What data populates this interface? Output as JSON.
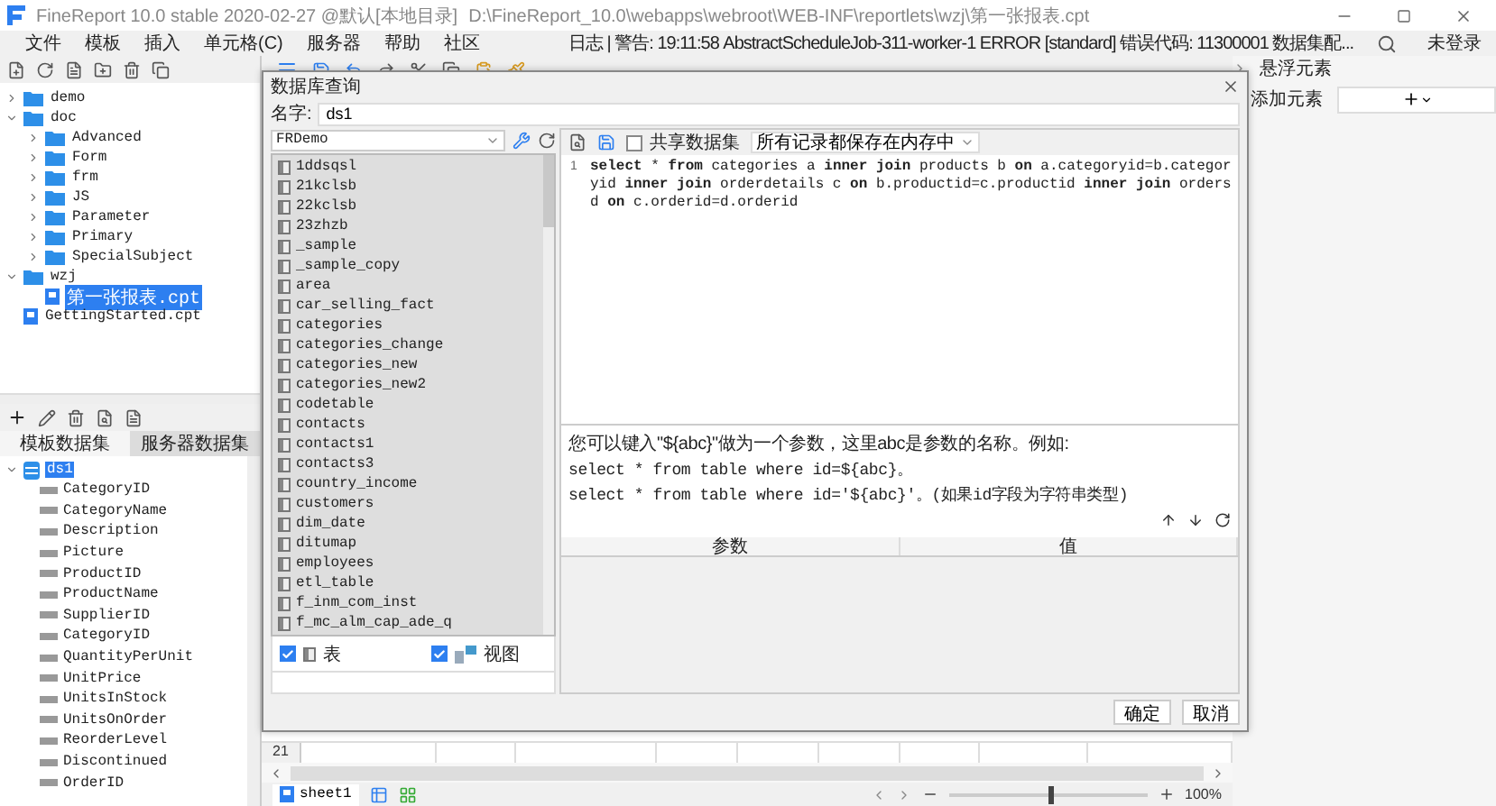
{
  "window": {
    "title": "FineReport 10.0 stable 2020-02-27 @默认[本地目录]",
    "path": "D:\\FineReport_10.0\\webapps\\webroot\\WEB-INF\\reportlets\\wzj\\第一张报表.cpt"
  },
  "menu": [
    "文件",
    "模板",
    "插入",
    "单元格(C)",
    "服务器",
    "帮助",
    "社区"
  ],
  "log_message": "日志 | 警告: 19:11:58 AbstractScheduleJob-311-worker-1 ERROR [standard] 错误代码: 11300001 数据集配...",
  "user": "未登录",
  "file_tree": [
    {
      "label": "demo",
      "kind": "folder",
      "expanded": false,
      "selected": false
    },
    {
      "label": "doc",
      "kind": "folder",
      "expanded": true,
      "selected": false,
      "children": [
        {
          "label": "Advanced",
          "kind": "folder",
          "expanded": false,
          "selected": false
        },
        {
          "label": "Form",
          "kind": "folder",
          "expanded": false,
          "selected": false
        },
        {
          "label": "frm",
          "kind": "folder",
          "expanded": false,
          "selected": false
        },
        {
          "label": "JS",
          "kind": "folder",
          "expanded": false,
          "selected": false
        },
        {
          "label": "Parameter",
          "kind": "folder",
          "expanded": false,
          "selected": false
        },
        {
          "label": "Primary",
          "kind": "folder",
          "expanded": false,
          "selected": false
        },
        {
          "label": "SpecialSubject",
          "kind": "folder",
          "expanded": false,
          "selected": false
        }
      ]
    },
    {
      "label": "wzj",
      "kind": "folder",
      "expanded": true,
      "selected": false,
      "children": [
        {
          "label": "第一张报表.cpt",
          "kind": "file",
          "selected": true
        }
      ]
    },
    {
      "label": "GettingStarted.cpt",
      "kind": "file",
      "selected": false
    }
  ],
  "dataset_tabs": [
    {
      "label": "模板数据集",
      "selected": true
    },
    {
      "label": "服务器数据集",
      "selected": false
    }
  ],
  "datasets": [
    {
      "name": "ds1",
      "expanded": true,
      "selected": true,
      "fields": [
        "CategoryID",
        "CategoryName",
        "Description",
        "Picture",
        "ProductID",
        "ProductName",
        "SupplierID",
        "CategoryID",
        "QuantityPerUnit",
        "UnitPrice",
        "UnitsInStock",
        "UnitsOnOrder",
        "ReorderLevel",
        "Discontinued",
        "OrderID"
      ]
    }
  ],
  "dialog": {
    "title": "数据库查询",
    "name_label": "名字:",
    "name_value": "ds1",
    "connection": "FRDemo",
    "tables": [
      "1ddsqsl",
      "21kclsb",
      "22kclsb",
      "23zhzb",
      "_sample",
      "_sample_copy",
      "area",
      "car_selling_fact",
      "categories",
      "categories_change",
      "categories_new",
      "categories_new2",
      "codetable",
      "contacts",
      "contacts1",
      "contacts3",
      "country_income",
      "customers",
      "dim_date",
      "ditumap",
      "employees",
      "etl_table",
      "f_inm_com_inst",
      "f_mc_alm_cap_ade_q"
    ],
    "filters": [
      {
        "label": "表",
        "kind": "table",
        "checked": true
      },
      {
        "label": "视图",
        "kind": "view",
        "checked": true
      }
    ],
    "share_dataset": {
      "label": "共享数据集",
      "checked": false
    },
    "storage_mode": "所有记录都保存在内存中",
    "sql_lines": [
      {
        "number": "1",
        "code": "**select**  *  **from** categories a  **inner join**  products  b **on** a.categoryid=b.categoryid **inner join**  orderdetails c **on**  b.productid=c.productid  **inner join** orders d **on** c.orderid=d.orderid"
      }
    ],
    "hint_lines": [
      "您可以键入\"${abc}\"做为一个参数，这里abc是参数的名称。例如:",
      "select * from table where id=${abc}。",
      "select * from table where id='${abc}'。(如果id字段为字符串类型)"
    ],
    "param_columns": [
      "参数",
      "值"
    ],
    "buttons": [
      "确定",
      "取消"
    ]
  },
  "grid": {
    "row_number": "21"
  },
  "sheet_tabs": [
    {
      "label": "sheet1",
      "selected": true
    }
  ],
  "zoom": {
    "level": 0.5,
    "reading": "100%"
  },
  "right_panel": {
    "title": "悬浮元素",
    "add_label": "添加元素"
  }
}
